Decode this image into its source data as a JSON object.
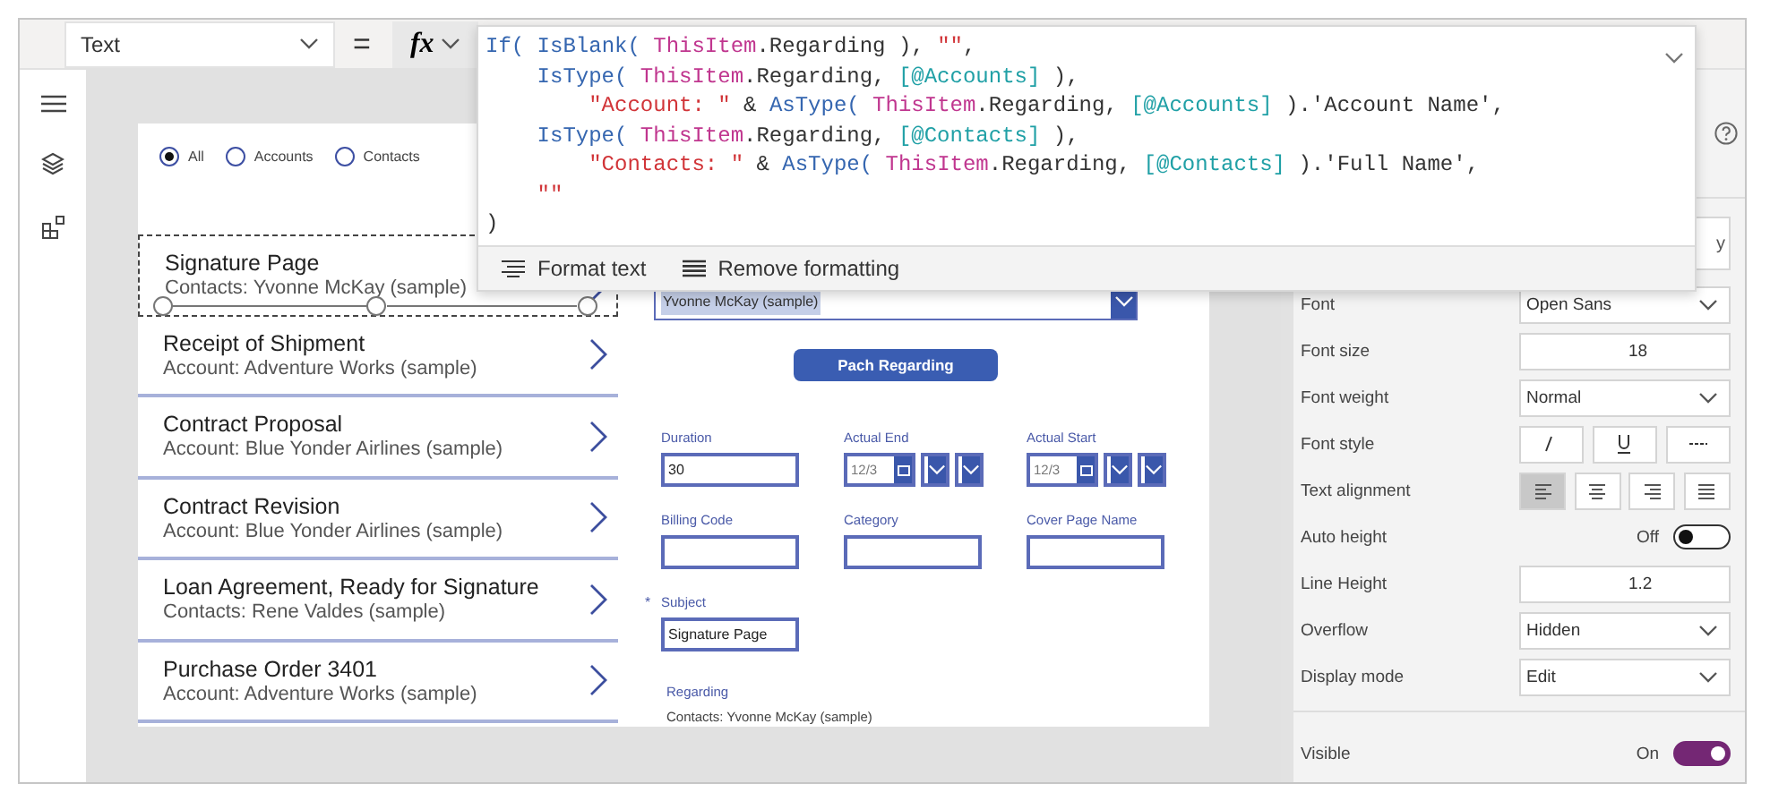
{
  "property_dropdown": {
    "value": "Text"
  },
  "equals": "=",
  "fx_button": {
    "label": "fx"
  },
  "formula": {
    "lines": [
      [
        {
          "kind": "function",
          "text": "If("
        },
        {
          "kind": "function",
          "text": " IsBlank("
        },
        {
          "kind": "object",
          "text": " ThisItem"
        },
        {
          "kind": "plain",
          "text": ".Regarding ), "
        },
        {
          "kind": "string",
          "text": "\"\""
        },
        {
          "kind": "plain",
          "text": ","
        }
      ],
      [
        {
          "kind": "function",
          "text": "    IsType("
        },
        {
          "kind": "object",
          "text": " ThisItem"
        },
        {
          "kind": "plain",
          "text": ".Regarding, "
        },
        {
          "kind": "entity",
          "text": "[@Accounts]"
        },
        {
          "kind": "plain",
          "text": " ),"
        }
      ],
      [
        {
          "kind": "string",
          "text": "        \"Account: \""
        },
        {
          "kind": "plain",
          "text": " & "
        },
        {
          "kind": "function",
          "text": "AsType("
        },
        {
          "kind": "object",
          "text": " ThisItem"
        },
        {
          "kind": "plain",
          "text": ".Regarding, "
        },
        {
          "kind": "entity",
          "text": "[@Accounts]"
        },
        {
          "kind": "plain",
          "text": " ).'Account Name',"
        }
      ],
      [
        {
          "kind": "function",
          "text": "    IsType("
        },
        {
          "kind": "object",
          "text": " ThisItem"
        },
        {
          "kind": "plain",
          "text": ".Regarding, "
        },
        {
          "kind": "entity",
          "text": "[@Contacts]"
        },
        {
          "kind": "plain",
          "text": " ),"
        }
      ],
      [
        {
          "kind": "string",
          "text": "        \"Contacts: \""
        },
        {
          "kind": "plain",
          "text": " & "
        },
        {
          "kind": "function",
          "text": "AsType("
        },
        {
          "kind": "object",
          "text": " ThisItem"
        },
        {
          "kind": "plain",
          "text": ".Regarding, "
        },
        {
          "kind": "entity",
          "text": "[@Contacts]"
        },
        {
          "kind": "plain",
          "text": " ).'Full Name',"
        }
      ],
      [
        {
          "kind": "string",
          "text": "    \"\""
        }
      ],
      [
        {
          "kind": "plain",
          "text": ")"
        }
      ]
    ],
    "toolbar": [
      {
        "kind": "format",
        "label": "Format text"
      },
      {
        "kind": "remove",
        "label": "Remove formatting"
      }
    ]
  },
  "app": {
    "radios": [
      {
        "label": "All",
        "selected": true
      },
      {
        "label": "Accounts",
        "selected": false
      },
      {
        "label": "Contacts",
        "selected": false
      }
    ],
    "gallery": [
      {
        "title": "Signature Page",
        "subtitle": "Contacts: Yvonne McKay (sample)",
        "selected": true
      },
      {
        "title": "Receipt of Shipment",
        "subtitle": "Account: Adventure Works (sample)",
        "selected": false
      },
      {
        "title": "Contract Proposal",
        "subtitle": "Account: Blue Yonder Airlines (sample)",
        "selected": false
      },
      {
        "title": "Contract Revision",
        "subtitle": "Account: Blue Yonder Airlines (sample)",
        "selected": false
      },
      {
        "title": "Loan Agreement, Ready for Signature",
        "subtitle": "Contacts: Rene Valdes (sample)",
        "selected": false
      },
      {
        "title": "Purchase Order 3401",
        "subtitle": "Account: Adventure Works (sample)",
        "selected": false
      }
    ],
    "form": {
      "dropdown": {
        "value": "Yvonne McKay (sample)"
      },
      "button": {
        "label": "Pach Regarding"
      },
      "fields": [
        {
          "label": "Duration",
          "kind": "text",
          "value": "30"
        },
        {
          "label": "Actual End",
          "kind": "datetime",
          "value": "12/3"
        },
        {
          "label": "Actual Start",
          "kind": "datetime",
          "value": "12/3"
        },
        {
          "label": "Billing Code",
          "kind": "text"
        },
        {
          "label": "Category",
          "kind": "text"
        },
        {
          "label": "Cover Page Name",
          "kind": "text"
        },
        {
          "label": "Subject",
          "kind": "text",
          "value": "Signature Page",
          "required_mark": "*"
        }
      ],
      "regarding": {
        "label": "Regarding",
        "value": "Contacts: Yvonne McKay (sample)"
      }
    }
  },
  "panel": {
    "partial_button": {
      "label": "y"
    },
    "properties": [
      {
        "label": "Font",
        "kind": "dropdown",
        "value": "Open Sans"
      },
      {
        "label": "Font size",
        "kind": "number",
        "value": "18"
      },
      {
        "label": "Font weight",
        "kind": "dropdown",
        "value": "Normal"
      },
      {
        "label": "Font style",
        "kind": "styles",
        "options": [
          {
            "kind": "italic"
          },
          {
            "kind": "underline"
          },
          {
            "kind": "strikethrough"
          }
        ]
      },
      {
        "label": "Text alignment",
        "kind": "align",
        "options": [
          {
            "kind": "left",
            "selected": true
          },
          {
            "kind": "center",
            "selected": false
          },
          {
            "kind": "right",
            "selected": false
          },
          {
            "kind": "justify",
            "selected": false
          }
        ]
      },
      {
        "label": "Auto height",
        "kind": "toggle",
        "state_label": "Off",
        "on": false
      },
      {
        "label": "Line Height",
        "kind": "number",
        "value": "1.2"
      },
      {
        "label": "Overflow",
        "kind": "dropdown",
        "value": "Hidden"
      },
      {
        "label": "Display mode",
        "kind": "dropdown",
        "value": "Edit"
      }
    ],
    "footer_properties": [
      {
        "label": "Visible",
        "kind": "toggle",
        "state_label": "On",
        "on": true
      }
    ]
  }
}
